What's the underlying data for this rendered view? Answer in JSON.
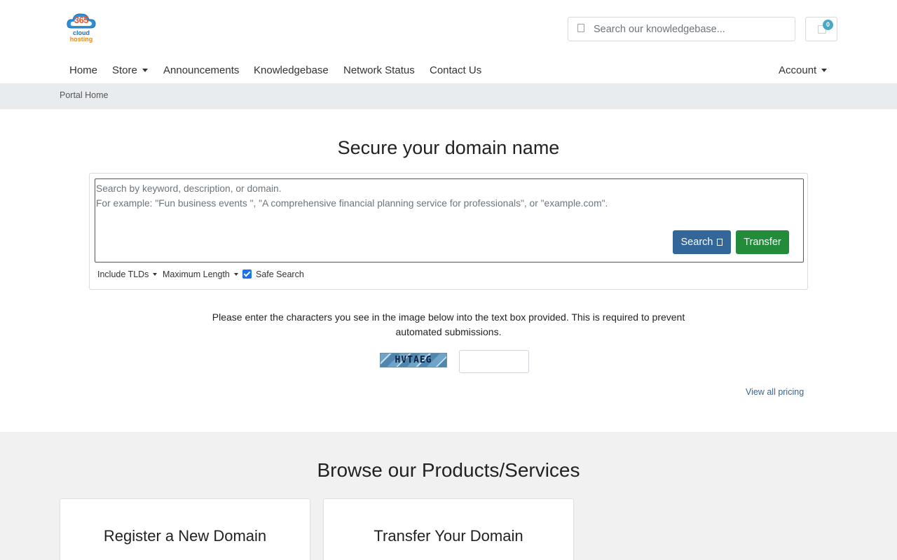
{
  "header": {
    "logo": {
      "brand_number": "365",
      "line1": "cloud",
      "line2": "hosting",
      "icon": "cloud-logo-icon"
    },
    "kb_search": {
      "placeholder": "Search our knowledgebase...",
      "icon": "search-icon"
    },
    "cart": {
      "count": "0",
      "icon": "shopping-cart-icon"
    }
  },
  "nav": {
    "items": [
      {
        "label": "Home"
      },
      {
        "label": "Store",
        "dropdown": true
      },
      {
        "label": "Announcements"
      },
      {
        "label": "Knowledgebase"
      },
      {
        "label": "Network Status"
      },
      {
        "label": "Contact Us"
      }
    ],
    "account": {
      "label": "Account",
      "dropdown": true
    }
  },
  "breadcrumb": {
    "current": "Portal Home"
  },
  "domain_search": {
    "title": "Secure your domain name",
    "placeholder": "Search by keyword, description, or domain.\nFor example: \"Fun business events \", \"A comprehensive financial planning service for professionals\", or \"example.com\".",
    "search_label": "Search",
    "transfer_label": "Transfer",
    "options": {
      "include_tlds": "Include TLDs",
      "max_length": "Maximum Length",
      "safe_search": "Safe Search",
      "safe_search_checked": true
    }
  },
  "captcha": {
    "instructions": "Please enter the characters you see in the image below into the text box provided. This is required to prevent automated submissions.",
    "image_text": "HVTAEG",
    "input_value": ""
  },
  "pricing_link": "View all pricing",
  "products": {
    "title": "Browse our Products/Services",
    "cards": [
      {
        "label": "Register a New Domain"
      },
      {
        "label": "Transfer Your Domain"
      }
    ]
  },
  "colors": {
    "primary": "#336699",
    "success": "#238c3b",
    "badge": "#49a9c4",
    "breadcrumb_bg": "#e9ecef",
    "products_bg": "#f1f1f1"
  }
}
